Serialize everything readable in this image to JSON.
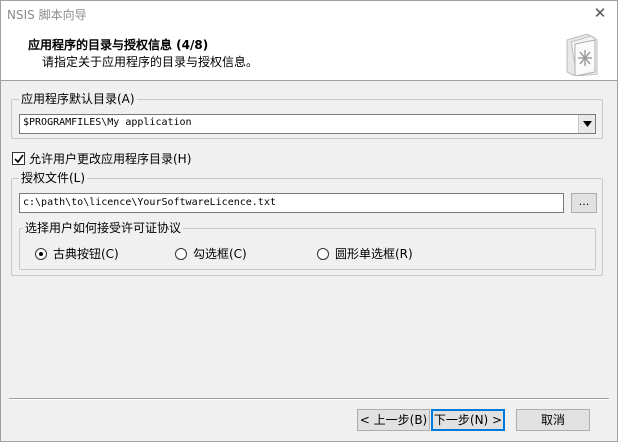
{
  "window": {
    "title": "NSIS 脚本向导"
  },
  "header": {
    "title": "应用程序的目录与授权信息 (4/8)",
    "subtitle": "请指定关于应用程序的目录与授权信息。",
    "icon": "setup-wizard-icon"
  },
  "directory": {
    "group_label": "应用程序默认目录(A)",
    "value": "$PROGRAMFILES\\My application"
  },
  "allow_change": {
    "label": "允许用户更改应用程序目录(H)",
    "checked": true
  },
  "licence": {
    "group_label": "授权文件(L)",
    "value": "c:\\path\\to\\licence\\YourSoftwareLicence.txt",
    "browse_label": "...",
    "accept": {
      "group_label": "选择用户如何接受许可证协议",
      "options": [
        {
          "label": "古典按钮(C)",
          "checked": true
        },
        {
          "label": "勾选框(C)",
          "checked": false
        },
        {
          "label": "圆形单选框(R)",
          "checked": false
        }
      ]
    }
  },
  "footer": {
    "back_label": "< 上一步(B)",
    "next_label": "下一步(N) >",
    "cancel_label": "取消"
  }
}
